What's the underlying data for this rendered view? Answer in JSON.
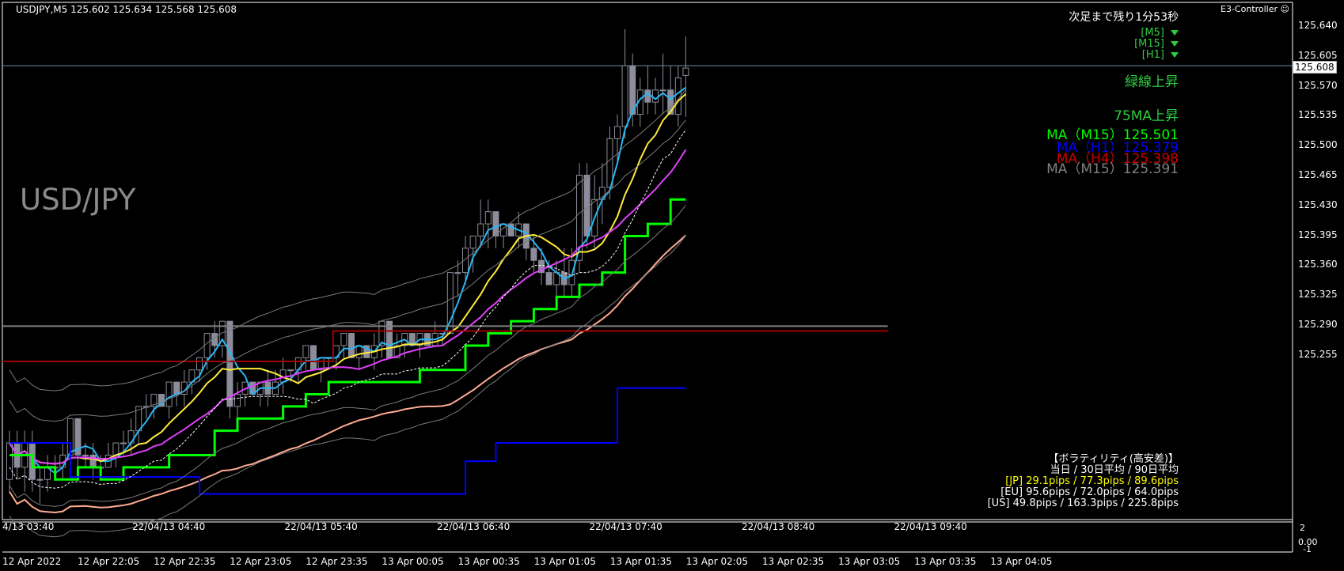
{
  "header": {
    "symbol_line": "USDJPY,M5  125.602 125.634 125.568 125.608",
    "controller": "E3-Controller",
    "countdown": "次足まで残り1分53秒"
  },
  "timeframes": [
    "[M5]",
    "[M15]",
    "[H1]"
  ],
  "signals": {
    "green_line": "緑線上昇",
    "ma75": "75MA上昇"
  },
  "ma_readouts": [
    {
      "label": "MA（M15）125.501",
      "color": "#00ff00"
    },
    {
      "label": "MA（H1）125.379",
      "color": "#0000ff"
    },
    {
      "label": "MA（H4）125.398",
      "color": "#cc0000"
    },
    {
      "label": "MA（M15）125.391",
      "color": "#808080"
    }
  ],
  "pair_title": "USD/JPY",
  "current_price": "125.608",
  "volatility": {
    "title": "【ボラティリティ(高安差)】",
    "header": "当日 / 30日平均 / 90日平均",
    "rows": [
      {
        "label": "[JP] 29.1pips / 77.3pips / 89.6pips",
        "color": "#ffff00"
      },
      {
        "label": "[EU] 95.6pips / 72.0pips / 64.0pips",
        "color": "#ffffff"
      },
      {
        "label": "[US] 49.8pips / 163.3pips / 225.8pips",
        "color": "#ffffff"
      }
    ]
  },
  "price_axis": [
    "125.640",
    "125.605",
    "125.570",
    "125.535",
    "125.500",
    "125.465",
    "125.430",
    "125.395",
    "125.360",
    "125.325",
    "125.290",
    "125.255"
  ],
  "sub_axis": [
    "2",
    "0.00",
    "-1"
  ],
  "upper_time_axis": [
    "4/13 03:40",
    "22/04/13 04:40",
    "22/04/13 05:40",
    "22/04/13 06:40",
    "22/04/13 07:40",
    "22/04/13 08:40",
    "22/04/13 09:40"
  ],
  "lower_time_axis": [
    "12 Apr 2022",
    "12 Apr 22:05",
    "12 Apr 22:35",
    "12 Apr 23:05",
    "12 Apr 23:35",
    "13 Apr 00:05",
    "13 Apr 00:35",
    "13 Apr 01:05",
    "13 Apr 01:35",
    "13 Apr 02:05",
    "13 Apr 02:35",
    "13 Apr 03:05",
    "13 Apr 03:35",
    "13 Apr 04:05"
  ],
  "chart_data": {
    "type": "candlestick",
    "price_range": [
      125.237,
      125.662
    ],
    "candles": [
      [
        125.27,
        125.31,
        125.26,
        125.3
      ],
      [
        125.3,
        125.31,
        125.27,
        125.28
      ],
      [
        125.28,
        125.31,
        125.26,
        125.3
      ],
      [
        125.3,
        125.31,
        125.26,
        125.27
      ],
      [
        125.27,
        125.28,
        125.25,
        125.27
      ],
      [
        125.27,
        125.29,
        125.26,
        125.28
      ],
      [
        125.28,
        125.29,
        125.27,
        125.28
      ],
      [
        125.28,
        125.3,
        125.27,
        125.29
      ],
      [
        125.29,
        125.32,
        125.28,
        125.32
      ],
      [
        125.32,
        125.32,
        125.28,
        125.29
      ],
      [
        125.29,
        125.3,
        125.28,
        125.29
      ],
      [
        125.29,
        125.3,
        125.27,
        125.28
      ],
      [
        125.28,
        125.29,
        125.27,
        125.28
      ],
      [
        125.28,
        125.3,
        125.28,
        125.29
      ],
      [
        125.29,
        125.3,
        125.28,
        125.3
      ],
      [
        125.3,
        125.31,
        125.29,
        125.3
      ],
      [
        125.3,
        125.32,
        125.29,
        125.31
      ],
      [
        125.31,
        125.33,
        125.3,
        125.33
      ],
      [
        125.33,
        125.34,
        125.32,
        125.33
      ],
      [
        125.33,
        125.34,
        125.32,
        125.34
      ],
      [
        125.34,
        125.34,
        125.33,
        125.33
      ],
      [
        125.33,
        125.35,
        125.32,
        125.35
      ],
      [
        125.35,
        125.35,
        125.33,
        125.34
      ],
      [
        125.34,
        125.36,
        125.33,
        125.35
      ],
      [
        125.35,
        125.36,
        125.34,
        125.36
      ],
      [
        125.36,
        125.37,
        125.35,
        125.37
      ],
      [
        125.37,
        125.39,
        125.36,
        125.39
      ],
      [
        125.39,
        125.4,
        125.37,
        125.38
      ],
      [
        125.38,
        125.4,
        125.37,
        125.4
      ],
      [
        125.4,
        125.4,
        125.32,
        125.33
      ],
      [
        125.33,
        125.35,
        125.32,
        125.34
      ],
      [
        125.34,
        125.35,
        125.33,
        125.35
      ],
      [
        125.35,
        125.35,
        125.34,
        125.34
      ],
      [
        125.34,
        125.35,
        125.33,
        125.35
      ],
      [
        125.35,
        125.36,
        125.33,
        125.34
      ],
      [
        125.34,
        125.36,
        125.34,
        125.35
      ],
      [
        125.35,
        125.37,
        125.34,
        125.36
      ],
      [
        125.36,
        125.36,
        125.35,
        125.36
      ],
      [
        125.36,
        125.37,
        125.35,
        125.37
      ],
      [
        125.37,
        125.38,
        125.36,
        125.38
      ],
      [
        125.38,
        125.38,
        125.36,
        125.36
      ],
      [
        125.36,
        125.37,
        125.35,
        125.37
      ],
      [
        125.37,
        125.37,
        125.36,
        125.37
      ],
      [
        125.37,
        125.38,
        125.36,
        125.38
      ],
      [
        125.38,
        125.39,
        125.37,
        125.39
      ],
      [
        125.39,
        125.39,
        125.37,
        125.37
      ],
      [
        125.37,
        125.38,
        125.36,
        125.38
      ],
      [
        125.38,
        125.38,
        125.37,
        125.37
      ],
      [
        125.37,
        125.39,
        125.36,
        125.38
      ],
      [
        125.38,
        125.4,
        125.37,
        125.4
      ],
      [
        125.4,
        125.4,
        125.37,
        125.37
      ],
      [
        125.37,
        125.39,
        125.37,
        125.38
      ],
      [
        125.38,
        125.39,
        125.37,
        125.39
      ],
      [
        125.39,
        125.39,
        125.38,
        125.38
      ],
      [
        125.38,
        125.39,
        125.37,
        125.39
      ],
      [
        125.39,
        125.39,
        125.38,
        125.38
      ],
      [
        125.38,
        125.4,
        125.38,
        125.39
      ],
      [
        125.39,
        125.39,
        125.38,
        125.39
      ],
      [
        125.39,
        125.44,
        125.39,
        125.44
      ],
      [
        125.44,
        125.45,
        125.42,
        125.44
      ],
      [
        125.44,
        125.47,
        125.43,
        125.46
      ],
      [
        125.46,
        125.47,
        125.44,
        125.47
      ],
      [
        125.47,
        125.5,
        125.46,
        125.48
      ],
      [
        125.48,
        125.5,
        125.46,
        125.49
      ],
      [
        125.49,
        125.49,
        125.46,
        125.47
      ],
      [
        125.47,
        125.48,
        125.46,
        125.48
      ],
      [
        125.48,
        125.48,
        125.47,
        125.47
      ],
      [
        125.47,
        125.49,
        125.46,
        125.48
      ],
      [
        125.48,
        125.48,
        125.45,
        125.46
      ],
      [
        125.46,
        125.47,
        125.44,
        125.45
      ],
      [
        125.45,
        125.46,
        125.43,
        125.44
      ],
      [
        125.44,
        125.45,
        125.43,
        125.43
      ],
      [
        125.43,
        125.45,
        125.42,
        125.44
      ],
      [
        125.44,
        125.46,
        125.42,
        125.43
      ],
      [
        125.43,
        125.46,
        125.42,
        125.45
      ],
      [
        125.45,
        125.53,
        125.44,
        125.52
      ],
      [
        125.52,
        125.53,
        125.46,
        125.47
      ],
      [
        125.47,
        125.52,
        125.46,
        125.5
      ],
      [
        125.5,
        125.53,
        125.48,
        125.51
      ],
      [
        125.51,
        125.56,
        125.5,
        125.55
      ],
      [
        125.55,
        125.57,
        125.53,
        125.56
      ],
      [
        125.56,
        125.64,
        125.55,
        125.61
      ],
      [
        125.61,
        125.62,
        125.56,
        125.57
      ],
      [
        125.57,
        125.6,
        125.56,
        125.59
      ],
      [
        125.59,
        125.61,
        125.57,
        125.58
      ],
      [
        125.58,
        125.6,
        125.57,
        125.59
      ],
      [
        125.59,
        125.62,
        125.57,
        125.59
      ],
      [
        125.59,
        125.61,
        125.57,
        125.57
      ],
      [
        125.57,
        125.61,
        125.56,
        125.6
      ],
      [
        125.602,
        125.634,
        125.568,
        125.608
      ]
    ]
  }
}
